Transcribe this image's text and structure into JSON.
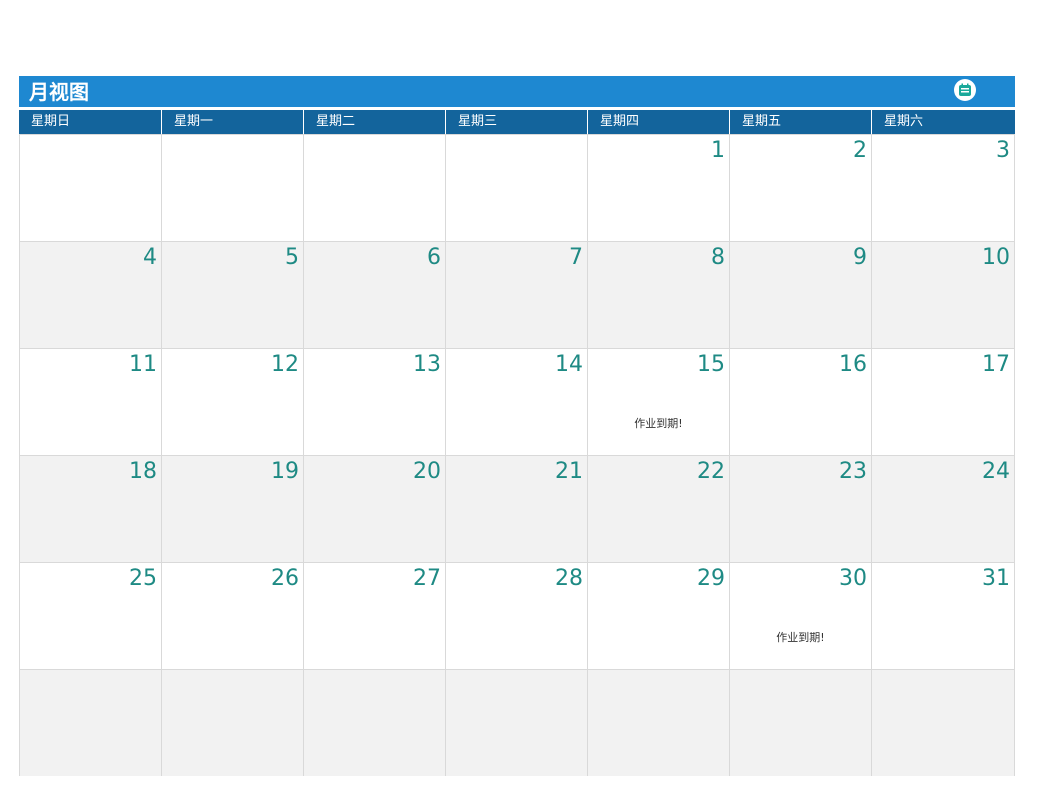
{
  "header": {
    "title": "月视图",
    "calendar_icon": "calendar-icon"
  },
  "weekdays": [
    "星期日",
    "星期一",
    "星期二",
    "星期三",
    "星期四",
    "星期五",
    "星期六"
  ],
  "weeks": [
    [
      {
        "day": ""
      },
      {
        "day": ""
      },
      {
        "day": ""
      },
      {
        "day": ""
      },
      {
        "day": "1"
      },
      {
        "day": "2"
      },
      {
        "day": "3"
      }
    ],
    [
      {
        "day": "4"
      },
      {
        "day": "5"
      },
      {
        "day": "6"
      },
      {
        "day": "7"
      },
      {
        "day": "8"
      },
      {
        "day": "9"
      },
      {
        "day": "10"
      }
    ],
    [
      {
        "day": "11"
      },
      {
        "day": "12"
      },
      {
        "day": "13"
      },
      {
        "day": "14"
      },
      {
        "day": "15",
        "note": "作业到期!"
      },
      {
        "day": "16"
      },
      {
        "day": "17"
      }
    ],
    [
      {
        "day": "18"
      },
      {
        "day": "19"
      },
      {
        "day": "20"
      },
      {
        "day": "21"
      },
      {
        "day": "22"
      },
      {
        "day": "23"
      },
      {
        "day": "24"
      }
    ],
    [
      {
        "day": "25"
      },
      {
        "day": "26"
      },
      {
        "day": "27"
      },
      {
        "day": "28"
      },
      {
        "day": "29"
      },
      {
        "day": "30",
        "note": "作业到期!"
      },
      {
        "day": "31"
      }
    ],
    [
      {
        "day": ""
      },
      {
        "day": ""
      },
      {
        "day": ""
      },
      {
        "day": ""
      },
      {
        "day": ""
      },
      {
        "day": ""
      },
      {
        "day": ""
      }
    ]
  ],
  "colors": {
    "title_bar": "#1e88d1",
    "weekday_bar": "#13649c",
    "day_number": "#1e8a84",
    "alt_row": "#f2f2f2",
    "icon": "#1aa99a"
  }
}
